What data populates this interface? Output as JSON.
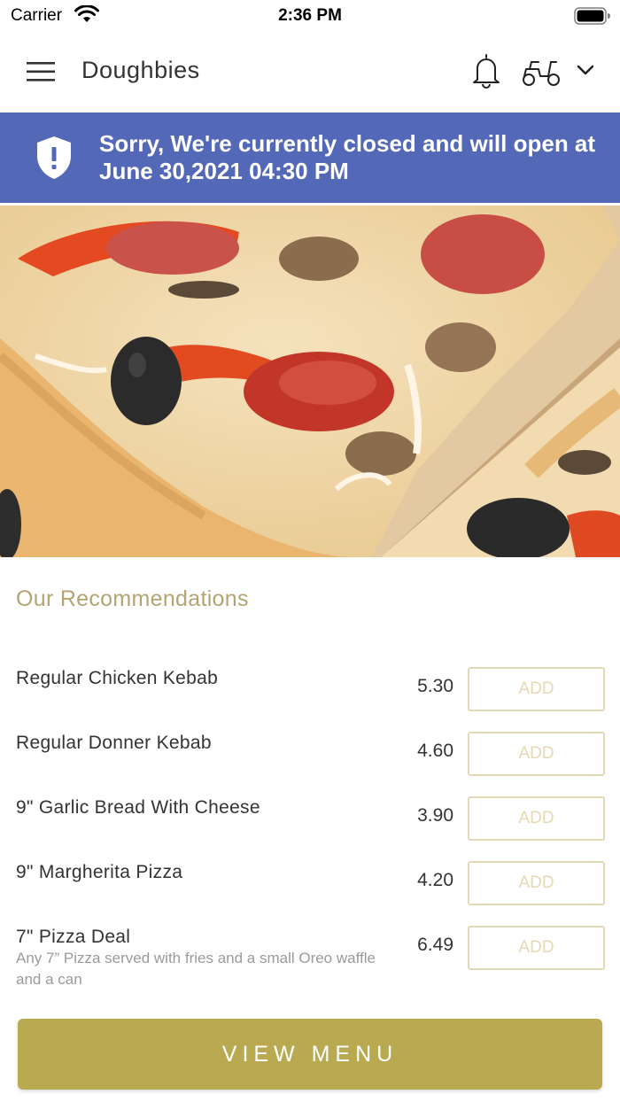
{
  "status_bar": {
    "carrier": "Carrier",
    "time": "2:36 PM"
  },
  "header": {
    "title": "Doughbies",
    "icons": [
      "menu-icon",
      "bell-icon",
      "scooter-icon",
      "chevron-down-icon"
    ]
  },
  "banner": {
    "text": "Sorry, We're currently closed and will open at June 30,2021 04:30 PM",
    "icon": "shield-alert-icon",
    "color": "#5468b8"
  },
  "recommendations": {
    "title": "Our Recommendations",
    "items": [
      {
        "name": "Regular Chicken Kebab",
        "price": "5.30",
        "button": "ADD"
      },
      {
        "name": "Regular Donner Kebab",
        "price": "4.60",
        "button": "ADD"
      },
      {
        "name": "9\" Garlic Bread With Cheese",
        "price": "3.90",
        "button": "ADD"
      },
      {
        "name": "9\" Margherita Pizza",
        "price": "4.20",
        "button": "ADD"
      },
      {
        "name": "7\" Pizza Deal",
        "description": "Any 7” Pizza served with fries and a small Oreo waffle and a can",
        "price": "6.49",
        "button": "ADD"
      }
    ]
  },
  "footer": {
    "view_menu": "VIEW MENU",
    "accent_color": "#b9a951"
  }
}
